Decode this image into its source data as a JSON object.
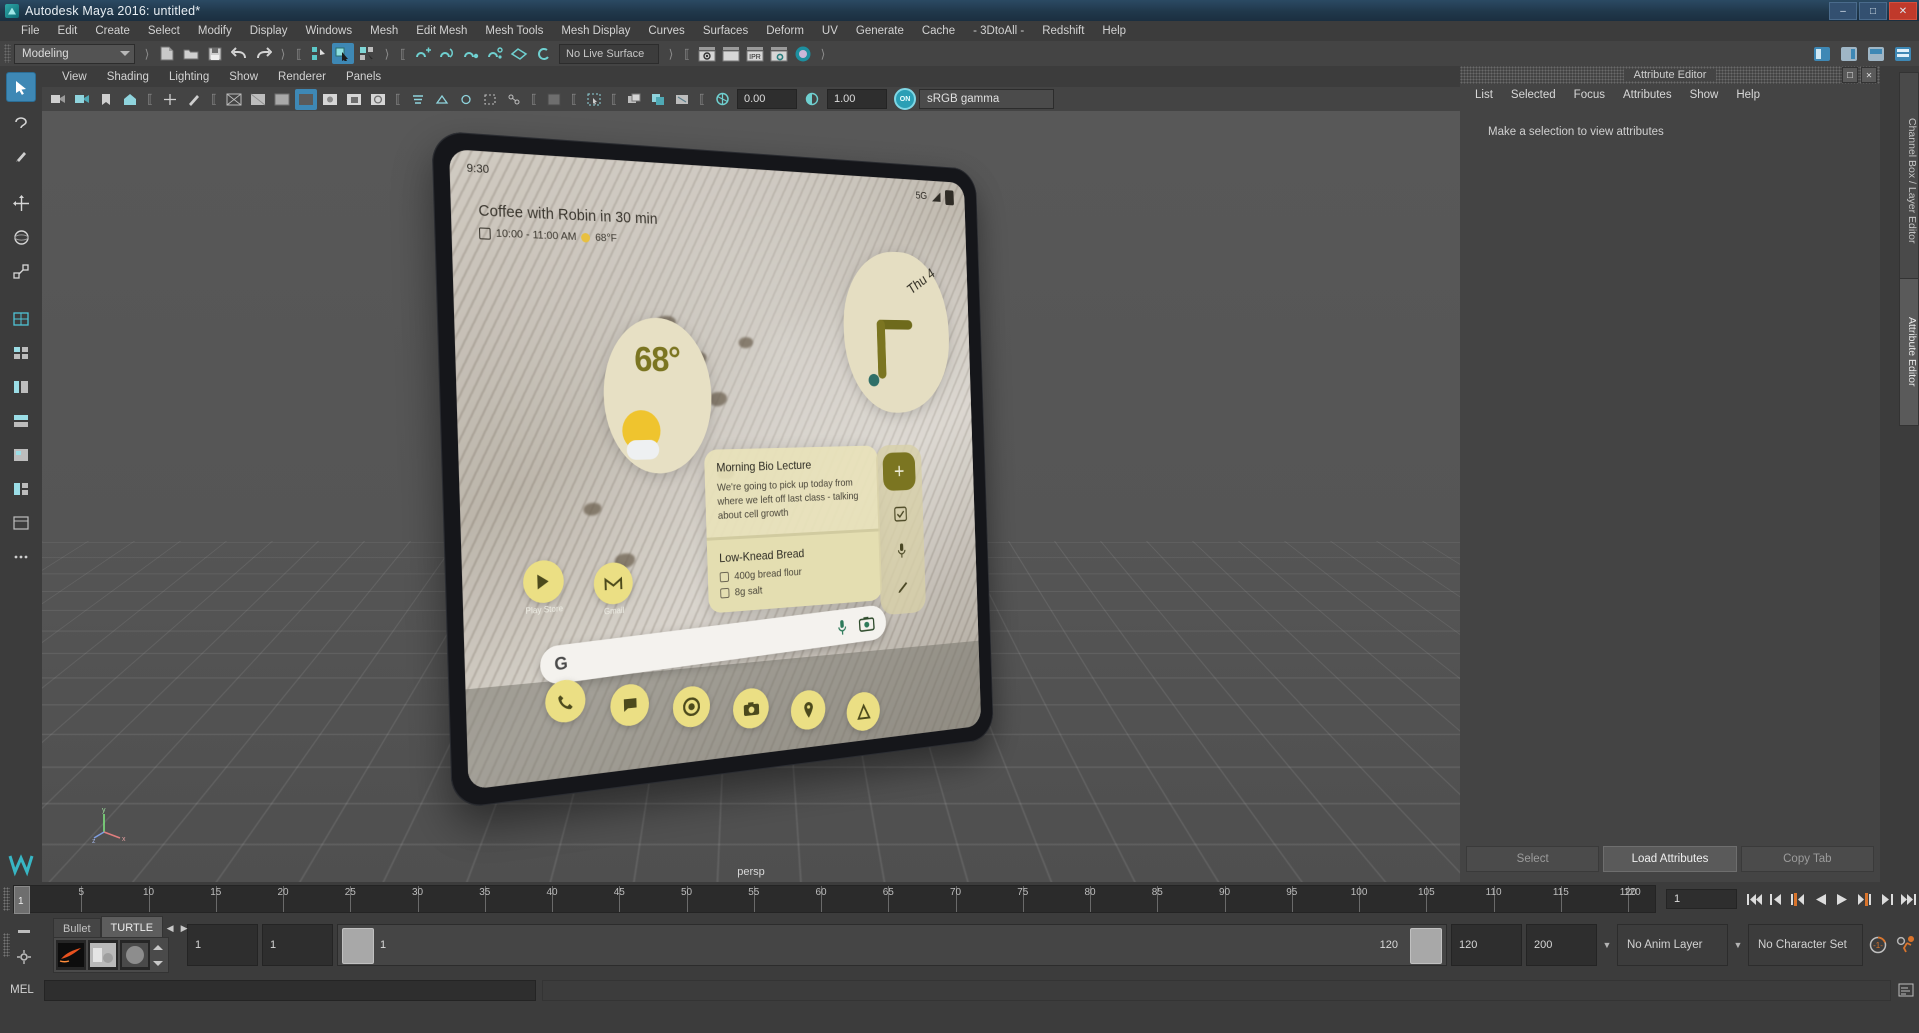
{
  "window": {
    "title": "Autodesk Maya 2016: untitled*",
    "logo_icon": "maya-logo-icon",
    "minimize_label": "–",
    "maximize_label": "□",
    "close_label": "✕"
  },
  "menubar": {
    "items": [
      {
        "label": "File"
      },
      {
        "label": "Edit"
      },
      {
        "label": "Create"
      },
      {
        "label": "Select"
      },
      {
        "label": "Modify"
      },
      {
        "label": "Display"
      },
      {
        "label": "Windows"
      },
      {
        "label": "Mesh"
      },
      {
        "label": "Edit Mesh"
      },
      {
        "label": "Mesh Tools"
      },
      {
        "label": "Mesh Display"
      },
      {
        "label": "Curves"
      },
      {
        "label": "Surfaces"
      },
      {
        "label": "Deform"
      },
      {
        "label": "UV"
      },
      {
        "label": "Generate"
      },
      {
        "label": "Cache"
      },
      {
        "label": "- 3DtoAll -"
      },
      {
        "label": "Redshift"
      },
      {
        "label": "Help"
      }
    ]
  },
  "toolbar": {
    "menuset": "Modeling",
    "live_surface": "No Live Surface",
    "icons": [
      "new-scene-icon",
      "open-scene-icon",
      "save-scene-icon",
      "undo-icon",
      "redo-icon",
      "select-by-hierarchy-icon",
      "select-by-object-icon",
      "select-by-component-icon",
      "snap-to-grid-icon",
      "snap-to-curve-icon",
      "snap-to-point-icon",
      "snap-to-projected-center-icon",
      "snap-to-view-plane-icon",
      "make-live-icon",
      "render-view-icon",
      "render-sequence-icon",
      "ipr-render-icon",
      "render-settings-icon",
      "hypershade-icon"
    ],
    "ipr_label": "IPR",
    "right_icons": [
      "workspace-icon",
      "sidebar-toggle-icon",
      "panel-layout-icon",
      "attribute-editor-toggle-icon"
    ]
  },
  "left_tools": {
    "items": [
      {
        "name": "select-tool",
        "selected": true
      },
      {
        "name": "lasso-tool",
        "selected": false
      },
      {
        "name": "paint-select-tool",
        "selected": false
      },
      {
        "name": "move-tool",
        "selected": false
      },
      {
        "name": "rotate-tool",
        "selected": false
      },
      {
        "name": "scale-tool",
        "selected": false
      },
      {
        "name": "last-tool",
        "selected": false
      }
    ],
    "layout_items": [
      "single-perspective-view-icon",
      "four-view-icon",
      "outliner-persp-icon",
      "persp-graph-icon",
      "persp-hypershade-icon",
      "persp-relationship-icon",
      "two-stacked-view-icon",
      "more-layouts-icon"
    ]
  },
  "viewport": {
    "menus": [
      {
        "label": "View"
      },
      {
        "label": "Shading"
      },
      {
        "label": "Lighting"
      },
      {
        "label": "Show"
      },
      {
        "label": "Renderer"
      },
      {
        "label": "Panels"
      }
    ],
    "exposure_value": "0.00",
    "gamma_value": "1.00",
    "color_management": "sRGB gamma",
    "color_management_on": "ON",
    "camera_label": "persp",
    "axis": {
      "x": "x",
      "y": "y",
      "z": "z"
    }
  },
  "device_screen": {
    "status_time": "9:30",
    "network": "5G",
    "signal_icon": "signal-bars-icon",
    "battery_icon": "battery-icon",
    "at_a_glance": {
      "headline": "Coffee with Robin in 30 min",
      "detail_time": "10:00 - 11:00 AM",
      "detail_temp": "68°F",
      "calendar_icon": "calendar-icon",
      "weather_icon": "sun-icon"
    },
    "weather_widget": {
      "temperature": "68°",
      "icon": "sun-behind-cloud-icon"
    },
    "clock_widget": {
      "day": "Thu 4",
      "icon": "analog-clock-icon"
    },
    "notes": [
      {
        "title": "Morning Bio Lecture",
        "body": "We're going to pick up today from where we left off last class - talking about cell growth",
        "items": []
      },
      {
        "title": "Low-Knead Bread",
        "body": "",
        "items": [
          "400g bread flour",
          "8g salt"
        ]
      }
    ],
    "note_rail": [
      "add-note-icon",
      "checklist-icon",
      "voice-note-icon",
      "draw-note-icon"
    ],
    "add_label": "+",
    "home_apps": [
      {
        "label": "Play Store",
        "icon": "play-store-icon"
      },
      {
        "label": "Gmail",
        "icon": "gmail-icon"
      }
    ],
    "search": {
      "logo": "google-g-icon",
      "mic_icon": "microphone-icon",
      "lens_icon": "google-lens-icon",
      "value": ""
    },
    "dock_apps": [
      {
        "icon": "phone-icon",
        "label": "Phone"
      },
      {
        "icon": "messages-icon",
        "label": "Messages"
      },
      {
        "icon": "chrome-icon",
        "label": "Chrome"
      },
      {
        "icon": "camera-icon",
        "label": "Camera"
      },
      {
        "icon": "maps-icon",
        "label": "Maps"
      },
      {
        "icon": "home-icon",
        "label": "Home"
      }
    ]
  },
  "attribute_editor": {
    "title": "Attribute Editor",
    "float_icon": "undock-icon",
    "close_icon": "close-icon",
    "menus": [
      {
        "label": "List"
      },
      {
        "label": "Selected"
      },
      {
        "label": "Focus"
      },
      {
        "label": "Attributes"
      },
      {
        "label": "Show"
      },
      {
        "label": "Help"
      }
    ],
    "empty_message": "Make a selection to view attributes",
    "footer": [
      {
        "label": "Select",
        "active": false
      },
      {
        "label": "Load Attributes",
        "active": true
      },
      {
        "label": "Copy Tab",
        "active": false
      }
    ]
  },
  "side_tabs": [
    {
      "label": "Channel Box / Layer Editor",
      "selected": false
    },
    {
      "label": "Attribute Editor",
      "selected": true
    }
  ],
  "time_slider": {
    "current_frame": "1",
    "frame_field": "1",
    "ticks": [
      5,
      10,
      15,
      20,
      25,
      30,
      35,
      40,
      45,
      50,
      55,
      60,
      65,
      70,
      75,
      80,
      85,
      90,
      95,
      100,
      105,
      110,
      115,
      120
    ],
    "end_label": "120",
    "playback_buttons": [
      "go-to-start-icon",
      "step-back-frame-icon",
      "step-back-key-icon",
      "play-backwards-icon",
      "play-forwards-icon",
      "step-forward-key-icon",
      "step-forward-frame-icon",
      "go-to-end-icon"
    ]
  },
  "range_slider": {
    "anim_start": "1",
    "range_start": "1",
    "range_start_label": "1",
    "range_end_label": "120",
    "range_end": "120",
    "anim_end": "200",
    "anim_layer": "No Anim Layer",
    "character_set": "No Character Set",
    "auto_key_icon": "auto-keyframe-icon",
    "anim_prefs_icon": "animation-preferences-icon"
  },
  "shelf": {
    "tabs": [
      {
        "label": "Bullet",
        "selected": false
      },
      {
        "label": "TURTLE",
        "selected": true
      }
    ],
    "prev_icon": "chevron-left-icon",
    "next_icon": "chevron-right-icon",
    "buttons": [
      "turtle-bake-icon",
      "turtle-render-icon",
      "turtle-sphere-icon"
    ],
    "menu_icon": "shelf-menu-icon",
    "settings_icon": "shelf-settings-icon"
  },
  "command_line": {
    "label": "MEL",
    "input_value": "",
    "output_value": "",
    "script_editor_icon": "script-editor-icon"
  },
  "colors": {
    "accent_blue": "#3e88b5",
    "panel_bg": "#3c3c3c",
    "toolbar_bg": "#444444",
    "title_bg": "#20384b",
    "device_yellow": "#ebdf84",
    "device_olive": "#7b7521"
  }
}
